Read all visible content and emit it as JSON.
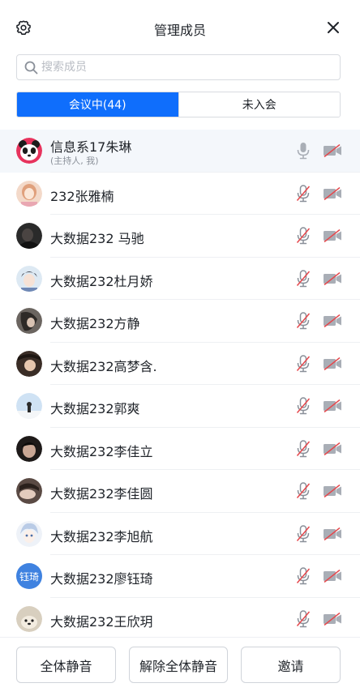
{
  "header": {
    "title": "管理成员",
    "settings_icon": "gear-icon",
    "close_icon": "close-icon"
  },
  "search": {
    "placeholder": "搜索成员",
    "value": ""
  },
  "tabs": [
    {
      "label": "会议中(44)",
      "active": true
    },
    {
      "label": "未入会",
      "active": false
    }
  ],
  "members": [
    {
      "name": "信息系17朱琳",
      "sub": "(主持人, 我)",
      "mic": "on",
      "camera": "off",
      "avatar": "panda"
    },
    {
      "name": "232张雅楠",
      "mic": "muted",
      "camera": "off",
      "avatar": "photo"
    },
    {
      "name": "大数据232 马驰",
      "mic": "muted",
      "camera": "off",
      "avatar": "photo"
    },
    {
      "name": "大数据232杜月娇",
      "mic": "muted",
      "camera": "off",
      "avatar": "photo"
    },
    {
      "name": "大数据232方静",
      "mic": "muted",
      "camera": "off",
      "avatar": "photo"
    },
    {
      "name": "大数据232高梦含.",
      "mic": "muted",
      "camera": "off",
      "avatar": "photo"
    },
    {
      "name": "大数据232郭爽",
      "mic": "muted",
      "camera": "off",
      "avatar": "photo"
    },
    {
      "name": "大数据232李佳立",
      "mic": "muted",
      "camera": "off",
      "avatar": "photo"
    },
    {
      "name": "大数据232李佳圆",
      "mic": "muted",
      "camera": "off",
      "avatar": "photo"
    },
    {
      "name": "大数据232李旭航",
      "mic": "muted",
      "camera": "off",
      "avatar": "photo"
    },
    {
      "name": "大数据232廖钰琦",
      "mic": "muted",
      "camera": "off",
      "avatar": "text",
      "avatar_text": "钰琦"
    },
    {
      "name": "大数据232王欣玥",
      "mic": "muted",
      "camera": "off",
      "avatar": "photo"
    }
  ],
  "footer": {
    "mute_all": "全体静音",
    "unmute_all": "解除全体静音",
    "invite": "邀请"
  },
  "colors": {
    "accent": "#0f6efc",
    "muted_red": "#e5484d",
    "icon_gray": "#8a9099",
    "avatar_text_bg": "#3f82e0"
  }
}
